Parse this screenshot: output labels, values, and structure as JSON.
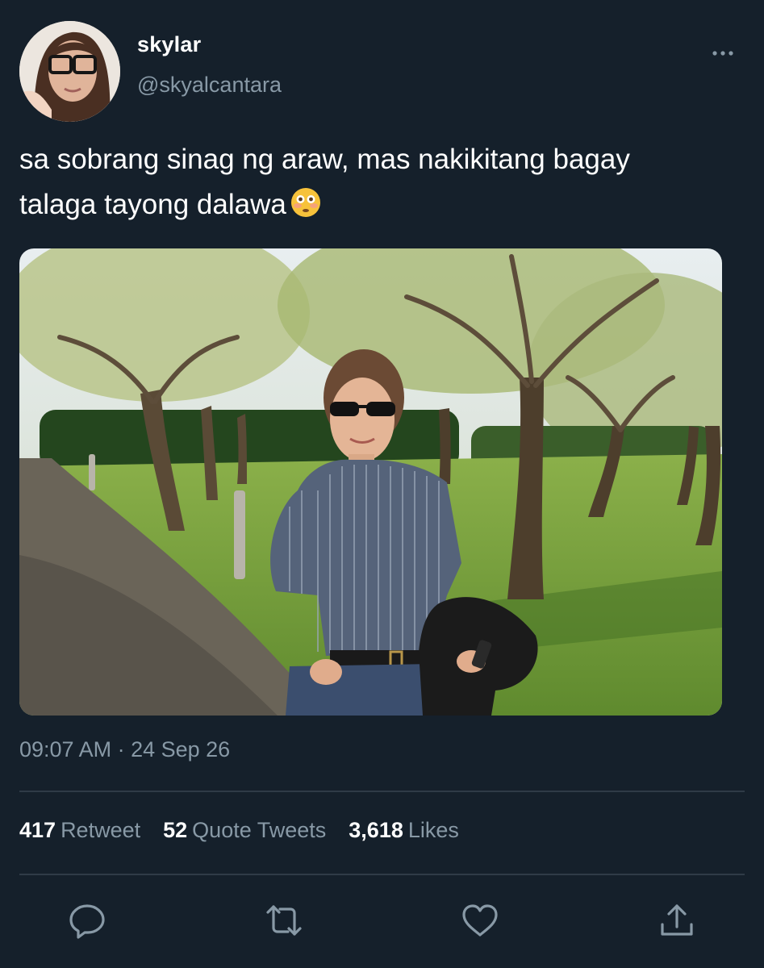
{
  "tweet": {
    "author": {
      "display_name": "skylar",
      "handle": "@skyalcantara"
    },
    "text_line1": "sa sobrang sinag ng araw, mas nakikitang bagay",
    "text_line2": "talaga tayong dalawa",
    "emoji": "flushed-face",
    "timestamp": "09:07 AM · 24 Sep 26",
    "stats": {
      "retweets": {
        "count": "417",
        "label": "Retweet"
      },
      "quotes": {
        "count": "52",
        "label": "Quote Tweets"
      },
      "likes": {
        "count": "3,618",
        "label": "Likes"
      }
    },
    "actions": [
      "reply-icon",
      "retweet-icon",
      "like-icon",
      "share-icon"
    ]
  },
  "colors": {
    "background": "#15202b",
    "secondary_text": "#8899a6",
    "divider": "#2f3b47",
    "icon": "#8899a6"
  }
}
